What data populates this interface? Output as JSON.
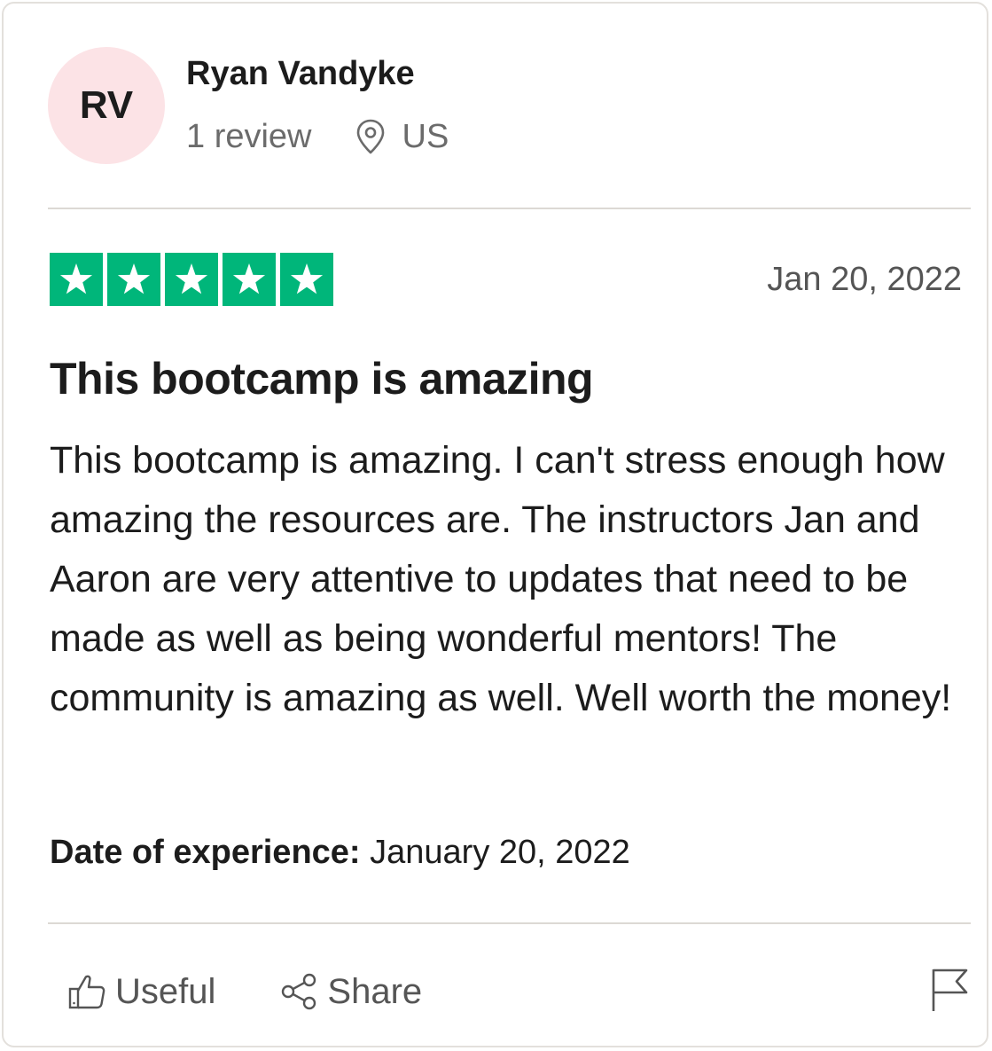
{
  "reviewer": {
    "initials": "RV",
    "name": "Ryan Vandyke",
    "review_count": "1 review",
    "location": "US",
    "avatar_color": "#fce3e6"
  },
  "review": {
    "rating": 5,
    "star_color": "#00b67a",
    "date": "Jan 20, 2022",
    "title": "This bootcamp is amazing",
    "body": "This bootcamp is amazing. I can't stress enough how amazing the resources are. The instructors Jan and Aaron are very attentive to updates that need to be made as well as being wonderful mentors! The community is amazing as well. Well worth the money!",
    "experience_label": "Date of experience:",
    "experience_date": "January 20, 2022"
  },
  "actions": {
    "useful_label": "Useful",
    "useful_icon": "thumbs-up-icon",
    "share_label": "Share",
    "share_icon": "share-icon",
    "report_icon": "flag-icon"
  }
}
